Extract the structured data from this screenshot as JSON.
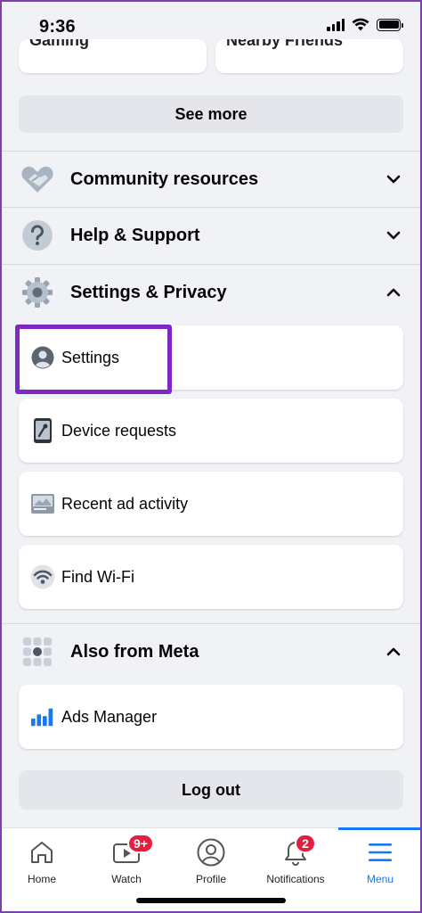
{
  "status_bar": {
    "time": "9:36"
  },
  "shortcuts": {
    "left_label": "Gaming",
    "right_label": "Nearby Friends"
  },
  "see_more_label": "See more",
  "sections": {
    "community": {
      "label": "Community resources",
      "icon": "handshake-icon"
    },
    "help": {
      "label": "Help & Support",
      "icon": "question-icon"
    },
    "settings_privacy": {
      "label": "Settings & Privacy",
      "icon": "gear-icon"
    },
    "also_meta": {
      "label": "Also from Meta",
      "icon": "grid-icon"
    }
  },
  "settings_items": [
    {
      "label": "Settings",
      "icon": "account-icon"
    },
    {
      "label": "Device requests",
      "icon": "phone-icon"
    },
    {
      "label": "Recent ad activity",
      "icon": "ad-activity-icon"
    },
    {
      "label": "Find Wi-Fi",
      "icon": "wifi-icon"
    }
  ],
  "meta_items": [
    {
      "label": "Ads Manager",
      "icon": "ads-manager-icon"
    }
  ],
  "logout_label": "Log out",
  "tabs": [
    {
      "label": "Home",
      "icon": "home-icon"
    },
    {
      "label": "Watch",
      "icon": "watch-icon",
      "badge": "9+"
    },
    {
      "label": "Profile",
      "icon": "profile-icon"
    },
    {
      "label": "Notifications",
      "icon": "bell-icon",
      "badge": "2"
    },
    {
      "label": "Menu",
      "icon": "menu-icon",
      "active": true
    }
  ],
  "colors": {
    "accent": "#1877f2",
    "highlight": "#7d27c4",
    "badge": "#e41e3f"
  }
}
